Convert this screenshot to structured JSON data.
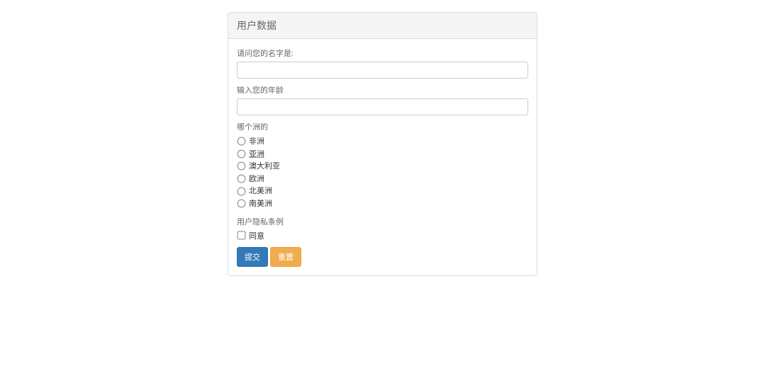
{
  "panel": {
    "title": "用户数据"
  },
  "form": {
    "nameLabel": "请问您的名字是:",
    "ageLabel": "输入您的年龄",
    "continentLabel": "哪个洲的",
    "continents": {
      "africa": "非洲",
      "asia": "亚洲",
      "australia": "澳大利亚",
      "europe": "欧洲",
      "northAmerica": "北美洲",
      "southAmerica": "南美洲"
    },
    "privacyLabel": "用户隐私条例",
    "agreeLabel": "同意",
    "submitLabel": "提交",
    "resetLabel": "重置"
  }
}
